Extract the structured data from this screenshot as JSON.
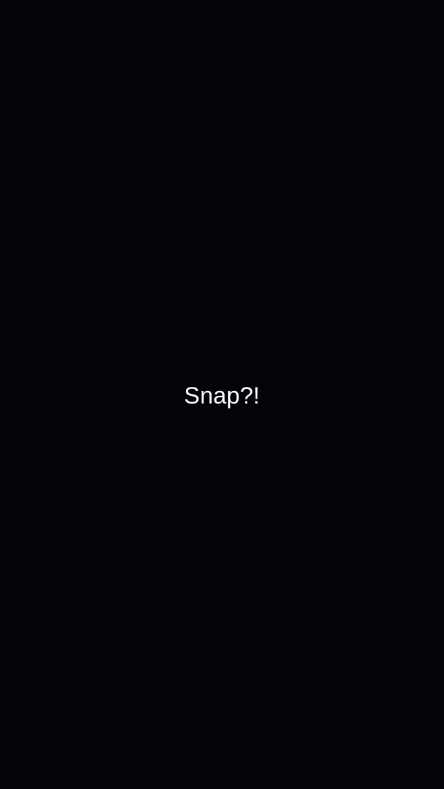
{
  "screen": {
    "message": "Snap?!"
  }
}
